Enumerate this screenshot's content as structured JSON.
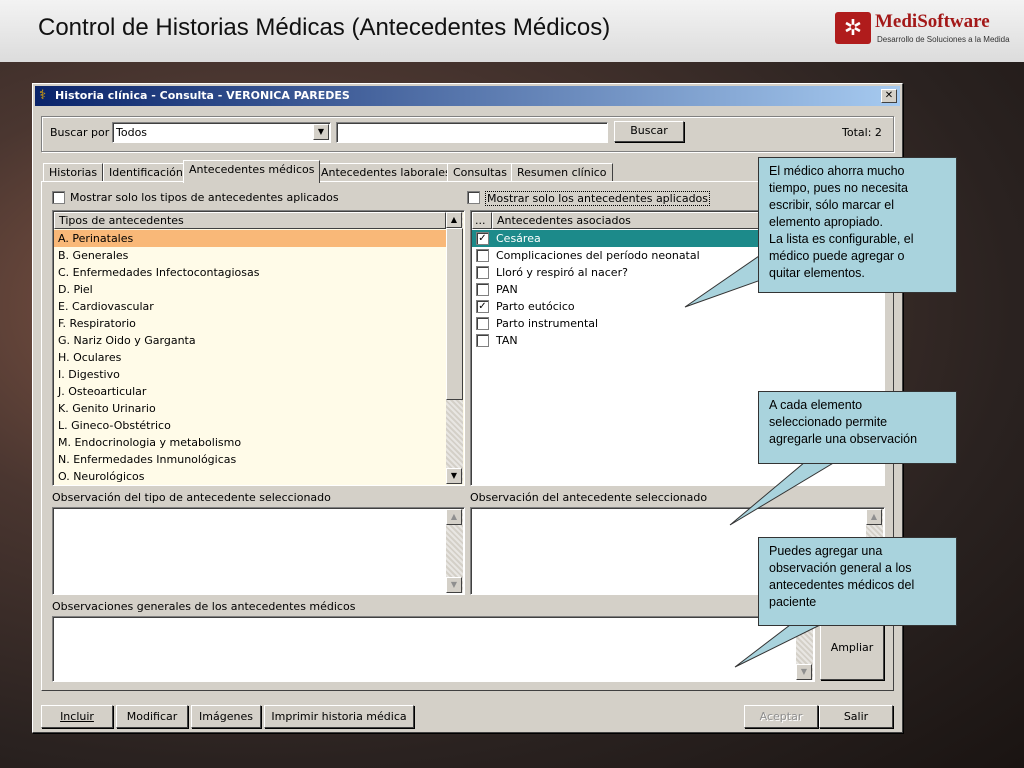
{
  "slide": {
    "title": "Control de Historias Médicas (Antecedentes Médicos)",
    "logo_name": "MediSoftware",
    "logo_subtitle": "Desarrollo de Soluciones a la Medida"
  },
  "window": {
    "title": "Historia clínica - Consulta - VERONICA PAREDES",
    "close_glyph": "✕"
  },
  "search": {
    "label": "Buscar por",
    "select_value": "Todos",
    "text_value": "",
    "button": "Buscar",
    "total": "Total: 2"
  },
  "tabs": [
    "Historias",
    "Identificación",
    "Antecedentes médicos",
    "Antecedentes laborales",
    "Consultas",
    "Resumen clínico"
  ],
  "left": {
    "filter_label": "Mostrar solo los tipos de antecedentes aplicados",
    "header": "Tipos de antecedentes",
    "items": [
      "A. Perinatales",
      "B. Generales",
      "C. Enfermedades Infectocontagiosas",
      "D. Piel",
      "E. Cardiovascular",
      "F. Respiratorio",
      "G. Nariz Oido y Garganta",
      "H. Oculares",
      "I. Digestivo",
      "J. Osteoarticular",
      "K. Genito Urinario",
      "L. Gineco-Obstétrico",
      "M. Endocrinologia y metabolismo",
      "N. Enfermedades Inmunológicas",
      "O. Neurológicos"
    ],
    "selected_index": 0,
    "observation_label": "Observación del tipo de antecedente seleccionado"
  },
  "right": {
    "filter_label": "Mostrar solo los antecedentes aplicados",
    "header_col1": "...",
    "header_col2": "Antecedentes asociados",
    "items": [
      {
        "label": "Cesárea",
        "checked": true,
        "selected": true
      },
      {
        "label": "Complicaciones del período neonatal",
        "checked": false,
        "selected": false
      },
      {
        "label": "Lloró y respiró al nacer?",
        "checked": false,
        "selected": false
      },
      {
        "label": "PAN",
        "checked": false,
        "selected": false
      },
      {
        "label": "Parto eutócico",
        "checked": true,
        "selected": false
      },
      {
        "label": "Parto instrumental",
        "checked": false,
        "selected": false
      },
      {
        "label": "TAN",
        "checked": false,
        "selected": false
      }
    ],
    "observation_label": "Observación del antecedente seleccionado"
  },
  "general": {
    "label": "Observaciones generales de los antecedentes médicos",
    "expand_button": "Ampliar"
  },
  "footer": {
    "incluir": "Incluir",
    "modificar": "Modificar",
    "imagenes": "Imágenes",
    "imprimir": "Imprimir historia médica",
    "aceptar": "Aceptar",
    "salir": "Salir"
  },
  "callouts": {
    "one": "El médico ahorra mucho\ntiempo, pues no necesita\nescribir, sólo marcar el\nelemento apropiado.\nLa lista es configurable, el\nmédico puede agregar o\nquitar elementos.",
    "two": "A cada elemento\nseleccionado permite\nagregarle una observación",
    "three": "Puedes agregar una\nobservación general a los\nantecedentes médicos del\npaciente"
  },
  "colors": {
    "selected_left": "#f9b878",
    "selected_right": "#1c8a8a",
    "list_bg": "#fffbe8",
    "callout": "#a9d3dd",
    "brand": "#a31818"
  }
}
